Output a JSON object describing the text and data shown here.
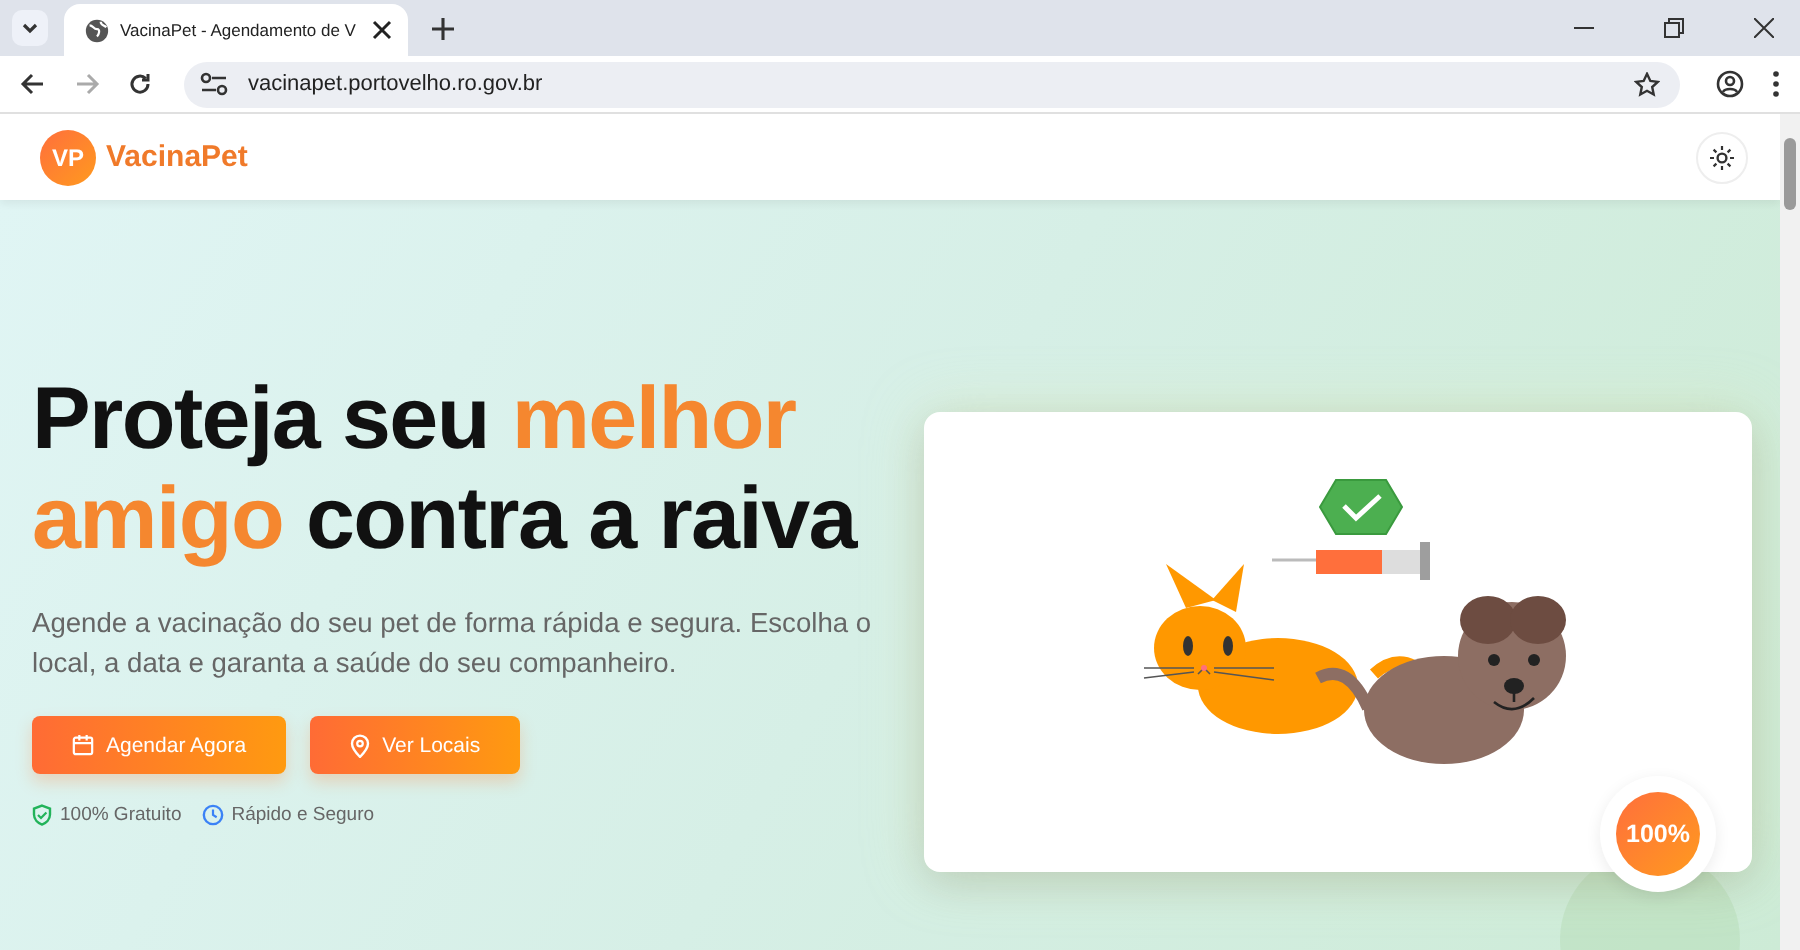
{
  "browser": {
    "tab_title": "VacinaPet - Agendamento de V",
    "url": "vacinapet.portovelho.ro.gov.br"
  },
  "header": {
    "logo_initials": "VP",
    "logo_text": "VacinaPet"
  },
  "hero": {
    "headline": [
      {
        "text": "Proteja seu ",
        "highlight": false
      },
      {
        "text": "melhor amigo",
        "highlight": true
      },
      {
        "text": " contra a raiva",
        "highlight": false
      }
    ],
    "description": "Agende a vacinação do seu pet de forma rápida e segura. Escolha o local, a data e garanta a saúde do seu companheiro.",
    "buttons": [
      {
        "label": "Agendar Agora"
      },
      {
        "label": "Ver Locais"
      }
    ],
    "features": [
      {
        "label": "100% Gratuito",
        "color": "#22b35a"
      },
      {
        "label": "Rápido e Seguro",
        "color": "#3b82f6"
      }
    ],
    "badge": "100%"
  }
}
